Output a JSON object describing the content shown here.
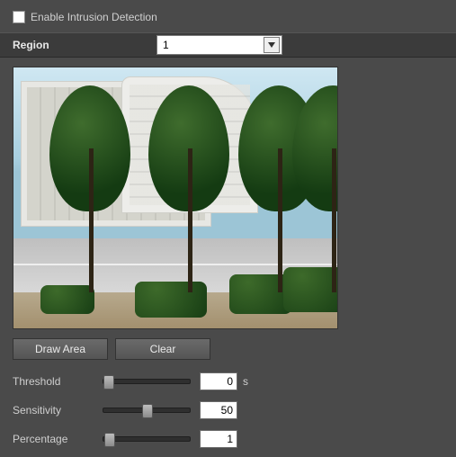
{
  "enable": {
    "label": "Enable Intrusion Detection",
    "checked": false
  },
  "region": {
    "label": "Region",
    "selected": "1"
  },
  "buttons": {
    "draw": "Draw Area",
    "clear": "Clear"
  },
  "sliders": {
    "threshold": {
      "label": "Threshold",
      "value": "0",
      "unit": "s",
      "pos": 0
    },
    "sensitivity": {
      "label": "Sensitivity",
      "value": "50",
      "pos": 50
    },
    "percentage": {
      "label": "Percentage",
      "value": "1",
      "pos": 1
    }
  }
}
